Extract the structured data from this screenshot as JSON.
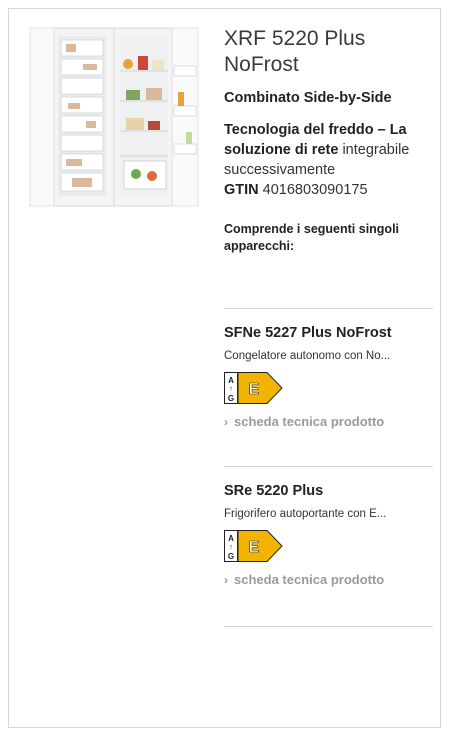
{
  "product": {
    "title": "XRF 5220 Plus NoFrost",
    "subtitle": "Combinato Side-by-Side",
    "tech_bold": "Tecnologia del freddo – La soluzione di rete",
    "tech_rest": "integrabile successivamente",
    "gtin_label": "GTIN",
    "gtin_value": "4016803090175"
  },
  "includes_heading": "Comprende i seguenti singoli apparecchi:",
  "appliances": [
    {
      "name": "SFNe 5227 Plus NoFrost",
      "description": "Congelatore autonomo con No...",
      "energy_class": "E",
      "energy_scale_top": "A",
      "energy_scale_bottom": "G",
      "link_label": "scheda tecnica prodotto"
    },
    {
      "name": "SRe 5220 Plus",
      "description": "Frigorifero autoportante con E...",
      "energy_class": "E",
      "energy_scale_top": "A",
      "energy_scale_bottom": "G",
      "link_label": "scheda tecnica prodotto"
    }
  ],
  "colors": {
    "energy_label": "#f2b400",
    "link": "#9a9a9a",
    "border": "#d6d6d6"
  }
}
